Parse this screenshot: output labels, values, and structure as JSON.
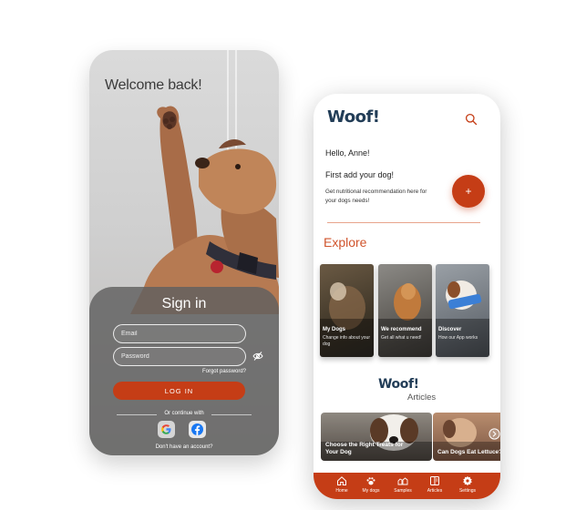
{
  "login": {
    "welcome": "Welcome back!",
    "title": "Sign in",
    "email_placeholder": "Email",
    "password_placeholder": "Password",
    "forgot": "Forgot password?",
    "login_button": "LOG IN",
    "or_continue": "Or continue with",
    "no_account": "Don't have an account?"
  },
  "home": {
    "logo": "Woof!",
    "greeting": "Hello, Anne!",
    "first_add": "First add your dog!",
    "nutrition": "Get nutritional recommendation here for your dogs needs!",
    "add_button": "+",
    "explore_title": "Explore",
    "explore_cards": [
      {
        "title": "My Dogs",
        "subtitle": "Change info about your dog"
      },
      {
        "title": "We recommend",
        "subtitle": "Get all what u need!"
      },
      {
        "title": "Discover",
        "subtitle": "How our App works"
      }
    ],
    "articles_logo": "Woof!",
    "articles_subtitle": "Articles",
    "articles": [
      {
        "title": "Choose the Right Treats for Your Dog"
      },
      {
        "title": "Can Dogs Eat Lettuce?"
      }
    ],
    "nav": [
      {
        "label": "Home",
        "icon": "home-icon"
      },
      {
        "label": "My dogs",
        "icon": "paw-icon"
      },
      {
        "label": "Samples",
        "icon": "dogs-icon"
      },
      {
        "label": "Articles",
        "icon": "book-icon"
      },
      {
        "label": "Settings",
        "icon": "gear-icon"
      }
    ]
  },
  "colors": {
    "accent": "#c53d16",
    "brand_navy": "#223d57",
    "explore_orange": "#d0542c"
  }
}
